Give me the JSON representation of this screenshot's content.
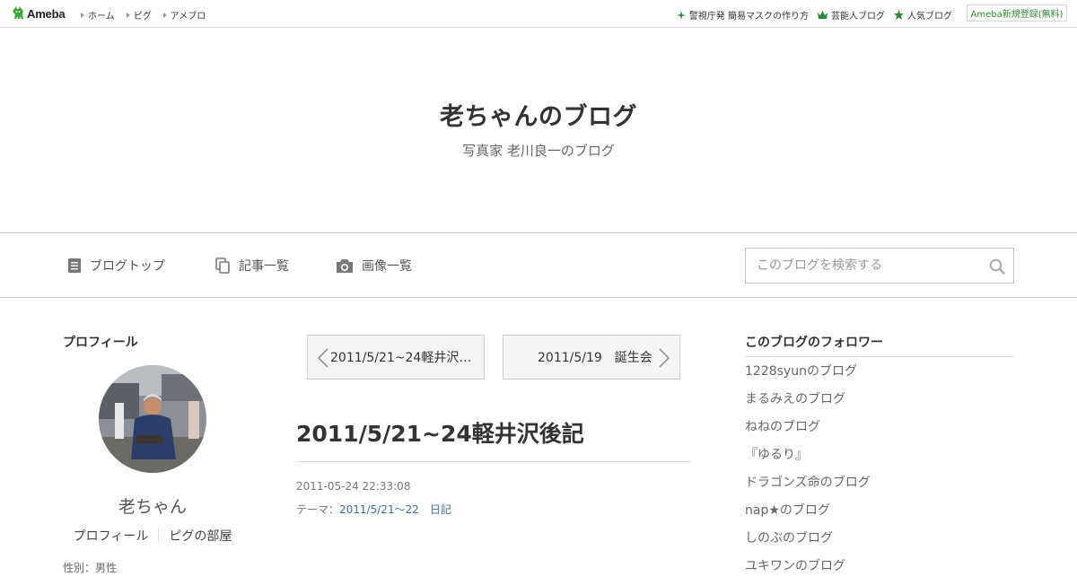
{
  "topbar": {
    "logo_text": "Ameba",
    "nav": [
      "ホーム",
      "ピグ",
      "アメブロ"
    ],
    "links": [
      {
        "label": "警視庁発 簡易マスクの作り方",
        "icon": "sparkle-icon"
      },
      {
        "label": "芸能人ブログ",
        "icon": "crown-icon"
      },
      {
        "label": "人気ブログ",
        "icon": "star-icon"
      }
    ],
    "register_label": "Ameba新規登録(無料)"
  },
  "header": {
    "title": "老ちゃんのブログ",
    "description": "写真家 老川良一のブログ"
  },
  "navbar": {
    "items": [
      {
        "label": "ブログトップ",
        "icon": "document-icon"
      },
      {
        "label": "記事一覧",
        "icon": "copy-icon"
      },
      {
        "label": "画像一覧",
        "icon": "camera-icon"
      }
    ],
    "search_placeholder": "このブログを検索する"
  },
  "profile": {
    "heading": "プロフィール",
    "name": "老ちゃん",
    "links": [
      "プロフィール",
      "ピグの部屋"
    ],
    "cut_text": "性別：男性"
  },
  "entry": {
    "prev_label": "2011/5/21~24軽井沢…",
    "next_label": "2011/5/19　誕生会",
    "title": "2011/5/21~24軽井沢後記",
    "date": "2011-05-24 22:33:08",
    "theme_prefix": "テーマ：",
    "theme_link": "2011/5/21〜22　日記"
  },
  "followers": {
    "heading": "このブログのフォロワー",
    "items": [
      "1228syunのブログ",
      "まるみえのブログ",
      "ねねのブログ",
      "『ゆるり』",
      "ドラゴンズ命のブログ",
      "nap★のブログ",
      "しのぶのブログ",
      "ユキワンのブログ"
    ]
  },
  "colors": {
    "brand_green": "#2d8a37",
    "link_blue": "#3b6fa0",
    "border": "#cccccc"
  }
}
